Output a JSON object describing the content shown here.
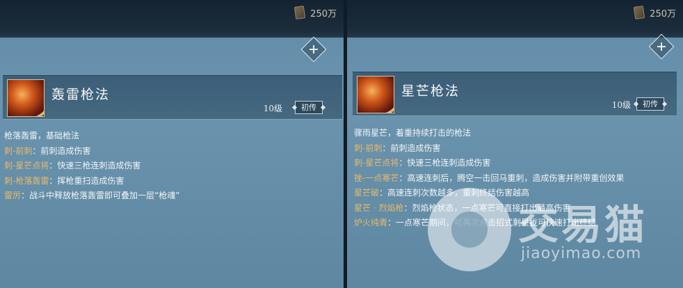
{
  "left": {
    "currency": "250万",
    "skill": {
      "name": "轰雷枪法",
      "level": "10级",
      "rank": "初传"
    },
    "lines": [
      {
        "key": "",
        "sep": "",
        "text": "枪落轰雷，基础枪法"
      },
      {
        "key": "刺-前刺",
        "sep": "：",
        "text": "前刺造成伤害"
      },
      {
        "key": "刺-星芒点将",
        "sep": "：",
        "text": "快速三枪连刺造成伤害"
      },
      {
        "key": "刺-枪落轰雷",
        "sep": "：",
        "text": "挥枪重扫造成伤害"
      },
      {
        "key": "雷厉",
        "sep": "：",
        "text": "战斗中释放枪落轰雷即可叠加一层“枪魂”"
      }
    ]
  },
  "right": {
    "currency": "250万",
    "skill": {
      "name": "星芒枪法",
      "level": "10级",
      "rank": "初传"
    },
    "lines": [
      {
        "key": "",
        "sep": "",
        "text": "骤雨星芒，着重持续打击的枪法"
      },
      {
        "key": "刺-前刺",
        "sep": "：",
        "text": "前刺造成伤害"
      },
      {
        "key": "刺-星芒点将",
        "sep": "：",
        "text": "快速三枪连刺造成伤害"
      },
      {
        "key": "挫-一点寒芒",
        "sep": "：",
        "text": "高速连刺后，腾空一击回马重刺，造成伤害并附带重创效果"
      },
      {
        "key": "星芒破",
        "sep": "：",
        "text": "高速连刺次数越多，重刺终结伤害越高"
      },
      {
        "key": "星芒 · 烈焰枪",
        "sep": "：",
        "text": "烈焰枪状态，一点寒芒可直接打出最高伤害"
      },
      {
        "key": "炉火纯青",
        "sep": "：",
        "text": "一点寒芒期间，可再次点击招式剩星拢可快速打出终结"
      }
    ]
  },
  "watermark": {
    "brand": "交易猫",
    "url": "jiaoyimao.com"
  },
  "icons": {
    "currency": "scroll-currency-icon",
    "settings": "diamond-settings-icon"
  },
  "colors": {
    "panel": "#6b94ae",
    "header": "#45697f",
    "key_text": "#e8b96c"
  }
}
